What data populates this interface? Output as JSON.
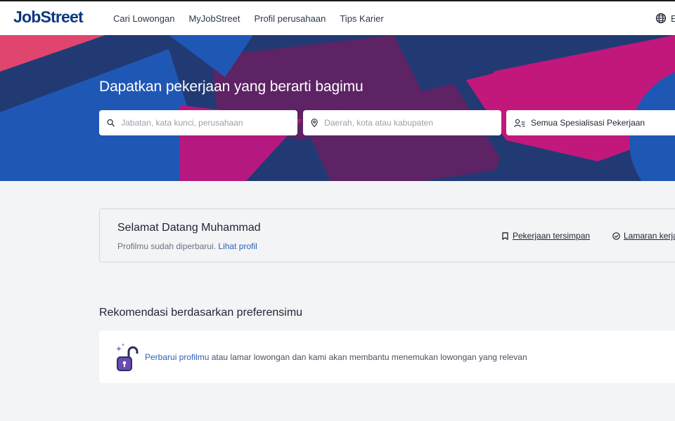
{
  "header": {
    "logo": "JobStreet",
    "nav": [
      "Cari Lowongan",
      "MyJobStreet",
      "Profil perusahaan",
      "Tips Karier"
    ],
    "language_initial": "E"
  },
  "hero": {
    "title": "Dapatkan pekerjaan yang berarti bagimu",
    "keyword_placeholder": "Jabatan, kata kunci, perusahaan",
    "location_placeholder": "Daerah, kota atau kabupaten",
    "classification_label": "Semua Spesialisasi Pekerjaan"
  },
  "welcome": {
    "title": "Selamat Datang Muhammad",
    "subtitle": "Profilmu sudah diperbarui.",
    "profile_link": "Lihat profil",
    "saved_jobs": "Pekerjaan tersimpan",
    "applied_jobs": "Lamaran kerja"
  },
  "recommendations": {
    "title": "Rekomendasi berdasarkan preferensimu",
    "link_text": "Perbarui profilmu",
    "body_text": "atau lamar lowongan dan kami akan membantu menemukan lowongan yang relevan"
  },
  "colors": {
    "brand_navy": "#0d3880",
    "hero_pink": "#c2187c",
    "hero_blue": "#1f57b4",
    "hero_purple": "#5d2364",
    "link_blue": "#2b5fb8"
  }
}
